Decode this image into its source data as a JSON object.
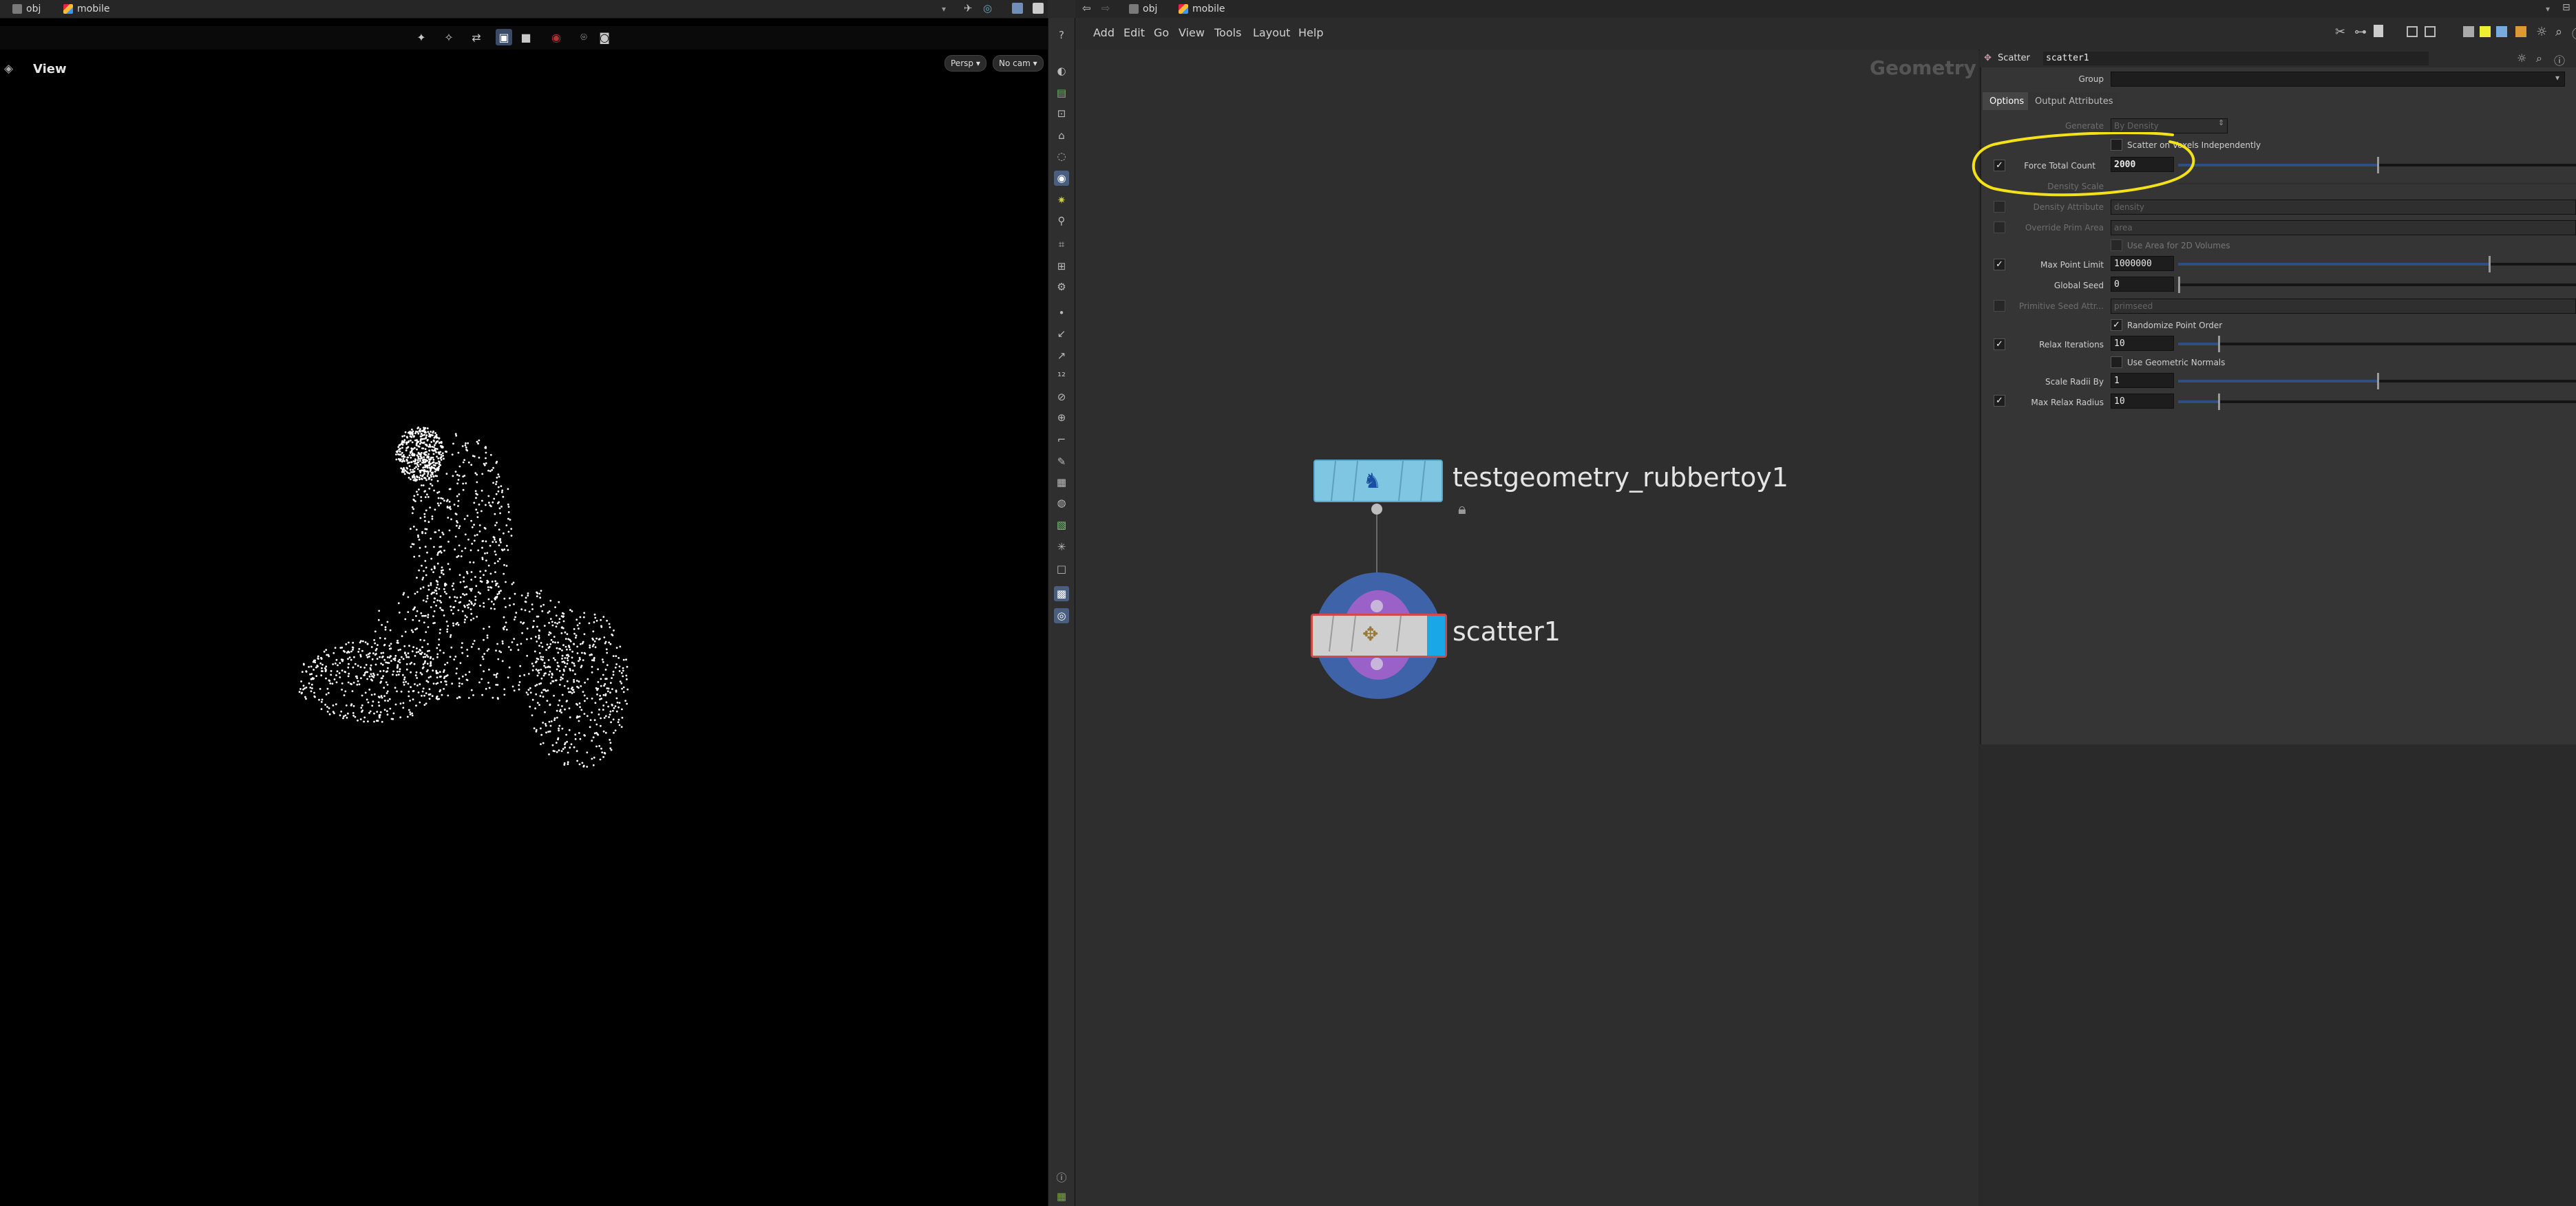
{
  "left_path": {
    "root": "obj",
    "node": "mobile"
  },
  "right_path": {
    "root": "obj",
    "node": "mobile"
  },
  "viewport": {
    "title": "View",
    "camera_mode": "Persp",
    "camera": "No cam"
  },
  "menu": [
    "Add",
    "Edit",
    "Go",
    "View",
    "Tools",
    "Layout",
    "Help"
  ],
  "network": {
    "context_label": "Geometry",
    "nodes": [
      {
        "name": "testgeometry_rubbertoy1",
        "color": "#7fc6e2",
        "locked": true
      },
      {
        "name": "scatter1",
        "color": "#cfcfcf",
        "display": true
      }
    ]
  },
  "params": {
    "node_type": "Scatter",
    "node_name": "scatter1",
    "group_label": "Group",
    "group_value": "",
    "tabs": [
      "Options",
      "Output Attributes"
    ],
    "generate": {
      "label": "Generate",
      "value": "By Density"
    },
    "scatter_voxels": {
      "label": "Scatter on Voxels Independently",
      "checked": false
    },
    "force_total_count": {
      "label": "Force Total Count",
      "value": "2000",
      "checked": true,
      "fill": 0.5
    },
    "density_scale": {
      "label": "Density Scale"
    },
    "density_attribute": {
      "label": "Density Attribute",
      "value": "density",
      "checked": false
    },
    "override_prim_area": {
      "label": "Override Prim Area",
      "value": "area",
      "checked": false
    },
    "use_area_2d": {
      "label": "Use Area for 2D Volumes",
      "checked": false
    },
    "max_point_limit": {
      "label": "Max Point Limit",
      "value": "1000000",
      "checked": true,
      "fill": 0.78
    },
    "global_seed": {
      "label": "Global Seed",
      "value": "0",
      "fill": 0.0
    },
    "primitive_seed_attr": {
      "label": "Primitive Seed Attr...",
      "value": "primseed",
      "checked": false
    },
    "randomize_point_order": {
      "label": "Randomize Point Order",
      "checked": true
    },
    "relax_iterations": {
      "label": "Relax Iterations",
      "value": "10",
      "checked": true,
      "fill": 0.1
    },
    "use_geometric_normals": {
      "label": "Use Geometric Normals",
      "checked": false
    },
    "scale_radii_by": {
      "label": "Scale Radii By",
      "value": "1",
      "fill": 0.5
    },
    "max_relax_radius": {
      "label": "Max Relax Radius",
      "value": "10",
      "checked": true,
      "fill": 0.1
    },
    "accent_color": "#2d4f82",
    "annotation_color": "#f5e11a"
  }
}
